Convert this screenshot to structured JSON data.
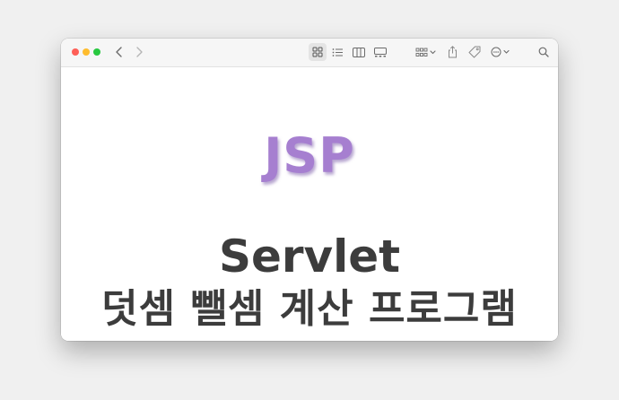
{
  "colors": {
    "page_background": "#f0f0f0",
    "window_background": "#ffffff",
    "toolbar_background": "#f6f6f6",
    "close": "#fe5f57",
    "minimize": "#febc2e",
    "maximize": "#28c840",
    "icon": "#6b6b6b",
    "logo": "#a67fd0",
    "logo_shadow": "#7a5aa8",
    "title": "#3c3c3c"
  },
  "toolbar": {
    "icons": [
      "back-icon",
      "forward-icon",
      "icon-view-icon",
      "list-view-icon",
      "column-view-icon",
      "gallery-view-icon",
      "group-icon",
      "share-icon",
      "tag-icon",
      "more-actions-icon",
      "search-icon"
    ],
    "active_view": "icon-view"
  },
  "content": {
    "logo_text": "JSP",
    "title_line1": "Servlet",
    "title_line2": "덧셈 뺄셈 계산 프로그램"
  }
}
